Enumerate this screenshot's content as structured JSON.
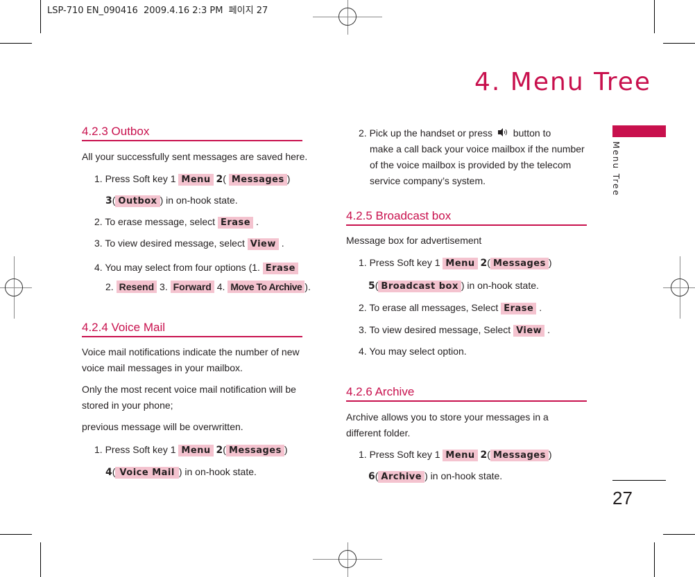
{
  "print_header": "LSP-710 EN_090416  2009.4.16 2:3 PM  페이지 27",
  "chapter_title": "4. Menu Tree",
  "side_tab_label": "Menu Tree",
  "page_number": "27",
  "accent_color": "#c8104d",
  "highlight_color": "#f4c3cf",
  "sections": {
    "outbox": {
      "title": "4.2.3 Outbox",
      "intro": "All your successfully sent messages are saved here.",
      "step1_prefix": "1. Press Soft key 1",
      "step1_key1": "Menu",
      "plus": "+",
      "step1_num2": "2",
      "step1_key2": "Messages",
      "step1_num3": "3",
      "step1_key3": "Outbox",
      "step1_suffix": ") in on-hook state.",
      "step2_text": "2. To erase message, select",
      "step2_key": "Erase",
      "step3_text": "3. To view desired message, select",
      "step3_key": "View",
      "step4_text": "4. You may select from four options (1.",
      "step4_opt1": "Erase",
      "step4_n2": "2.",
      "step4_opt2": "Resend",
      "step4_n3": "3.",
      "step4_opt3": "Forward",
      "step4_n4": "4.",
      "step4_opt4": "Move To Archive",
      "step4_end": ")."
    },
    "voicemail": {
      "title": "4.2.4 Voice Mail",
      "p1_line1": "Voice mail notifications indicate the number of new",
      "p1_line2": "voice mail messages in your mailbox.",
      "p2_line1": "Only the most recent voice mail notification will be",
      "p2_line2": "stored in your phone;",
      "p3": "previous message will be overwritten.",
      "step1_prefix": "1. Press Soft key 1",
      "step1_key1": "Menu",
      "step1_num2": "2",
      "step1_key2": "Messages",
      "step1_num3": "4",
      "step1_key3": "Voice Mail",
      "step1_suffix": ") in on-hook state.",
      "step2_line1_a": "2. Pick up the handset or press",
      "step2_icon": "speaker-icon",
      "step2_line1_b": "button to",
      "step2_line2": "make a call back your voice mailbox if the number",
      "step2_line3": "of the voice mailbox is provided by the telecom",
      "step2_line4": "service company’s system."
    },
    "broadcast": {
      "title": "4.2.5 Broadcast box",
      "intro": "Message box for advertisement",
      "step1_prefix": "1. Press Soft key 1",
      "step1_key1": "Menu",
      "step1_num2": "2",
      "step1_key2": "Messages",
      "step1_num3": "5",
      "step1_key3": "Broadcast box",
      "step1_suffix": ") in on-hook state.",
      "step2_text": "2. To erase all messages, Select",
      "step2_key": "Erase",
      "step3_text": "3. To view desired message, Select",
      "step3_key": "View",
      "step4_text": "4. You may select option."
    },
    "archive": {
      "title": "4.2.6 Archive",
      "intro_line1": "Archive allows you to store your messages in a",
      "intro_line2": "different folder.",
      "step1_prefix": "1. Press Soft key 1",
      "step1_key1": "Menu",
      "step1_num2": "2",
      "step1_key2": "Messages",
      "step1_num3": "6",
      "step1_key3": "Archive",
      "step1_suffix": ") in on-hook state."
    }
  }
}
